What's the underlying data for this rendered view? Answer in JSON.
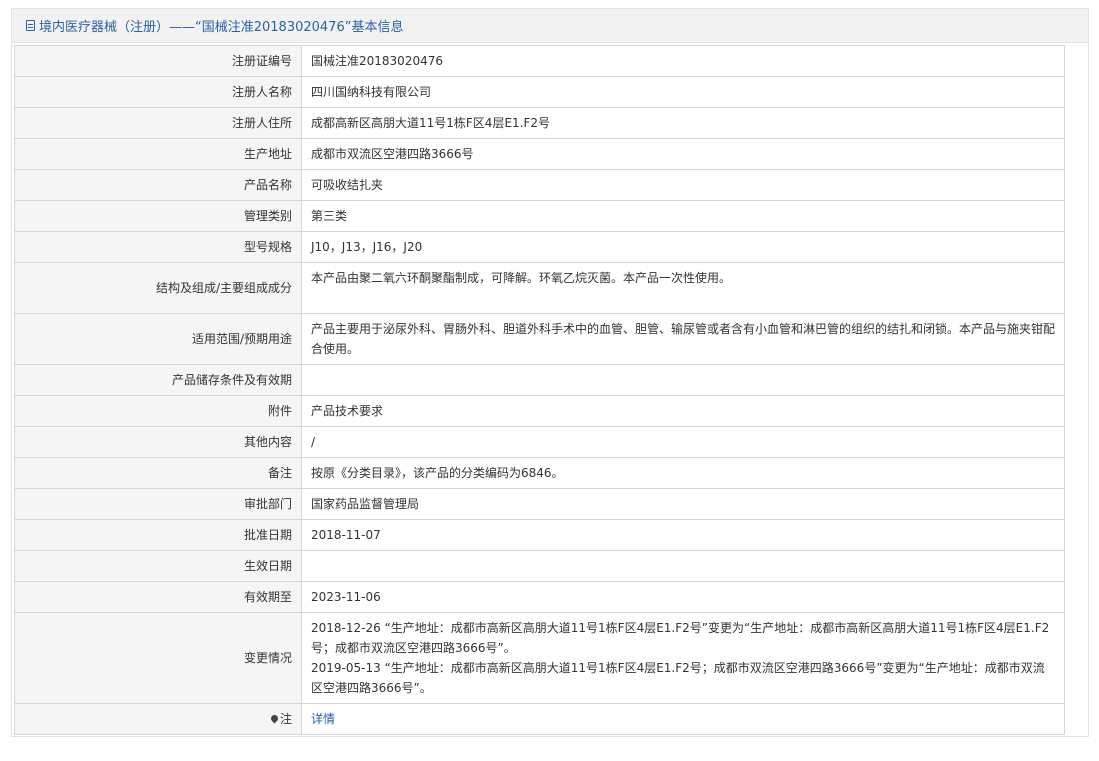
{
  "header": {
    "title": "境内医疗器械（注册）——“国械注准20183020476”基本信息"
  },
  "rows": [
    {
      "label": "注册证编号",
      "value": "国械注准20183020476"
    },
    {
      "label": "注册人名称",
      "value": "四川国纳科技有限公司"
    },
    {
      "label": "注册人住所",
      "value": "成都高新区高朋大道11号1栋F区4层E1.F2号"
    },
    {
      "label": "生产地址",
      "value": "成都市双流区空港四路3666号"
    },
    {
      "label": "产品名称",
      "value": "可吸收结扎夹"
    },
    {
      "label": "管理类别",
      "value": "第三类"
    },
    {
      "label": "型号规格",
      "value": "J10，J13，J16，J20"
    },
    {
      "label": "结构及组成/主要组成成分",
      "value": "本产品由聚二氧六环酮聚酯制成，可降解。环氧乙烷灭菌。本产品一次性使用。"
    },
    {
      "label": "适用范围/预期用途",
      "value": "产品主要用于泌尿外科、胃肠外科、胆道外科手术中的血管、胆管、输尿管或者含有小血管和淋巴管的组织的结扎和闭锁。本产品与施夹钳配合使用。"
    },
    {
      "label": "产品储存条件及有效期",
      "value": ""
    },
    {
      "label": "附件",
      "value": "产品技术要求"
    },
    {
      "label": "其他内容",
      "value": "/"
    },
    {
      "label": "备注",
      "value": "按原《分类目录》，该产品的分类编码为6846。"
    },
    {
      "label": "审批部门",
      "value": "国家药品监督管理局"
    },
    {
      "label": "批准日期",
      "value": "2018-11-07"
    },
    {
      "label": "生效日期",
      "value": ""
    },
    {
      "label": "有效期至",
      "value": "2023-11-06"
    }
  ],
  "change": {
    "label": "变更情况",
    "entries": [
      "2018-12-26 “生产地址：成都市高新区高朋大道11号1栋F区4层E1.F2号”变更为“生产地址：成都市高新区高朋大道11号1栋F区4层E1.F2号；成都市双流区空港四路3666号”。",
      "2019-05-13 “生产地址：成都市高新区高朋大道11号1栋F区4层E1.F2号；成都市双流区空港四路3666号”变更为“生产地址：成都市双流区空港四路3666号”。"
    ]
  },
  "note": {
    "icon": "pin-icon",
    "label": "注",
    "link_text": "详情",
    "link_color": "#2a62a8"
  }
}
